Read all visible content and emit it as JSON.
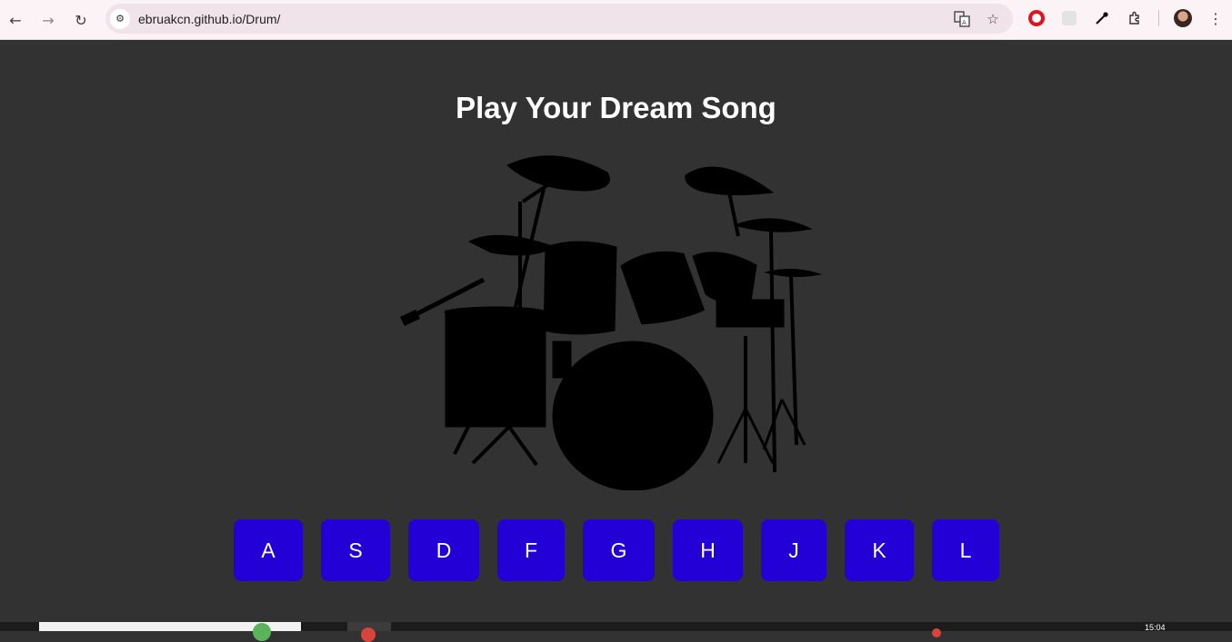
{
  "browser": {
    "url": "ebruakcn.github.io/Drum/",
    "nav": {
      "back_icon": "arrow-left-icon",
      "forward_icon": "arrow-right-icon",
      "reload_icon": "reload-icon"
    }
  },
  "page": {
    "title": "Play Your Dream Song",
    "keys": [
      "A",
      "S",
      "D",
      "F",
      "G",
      "H",
      "J",
      "K",
      "L"
    ],
    "key_color": "#2200d6",
    "background_color": "#323232"
  },
  "taskbar": {
    "clock": "15:04"
  }
}
